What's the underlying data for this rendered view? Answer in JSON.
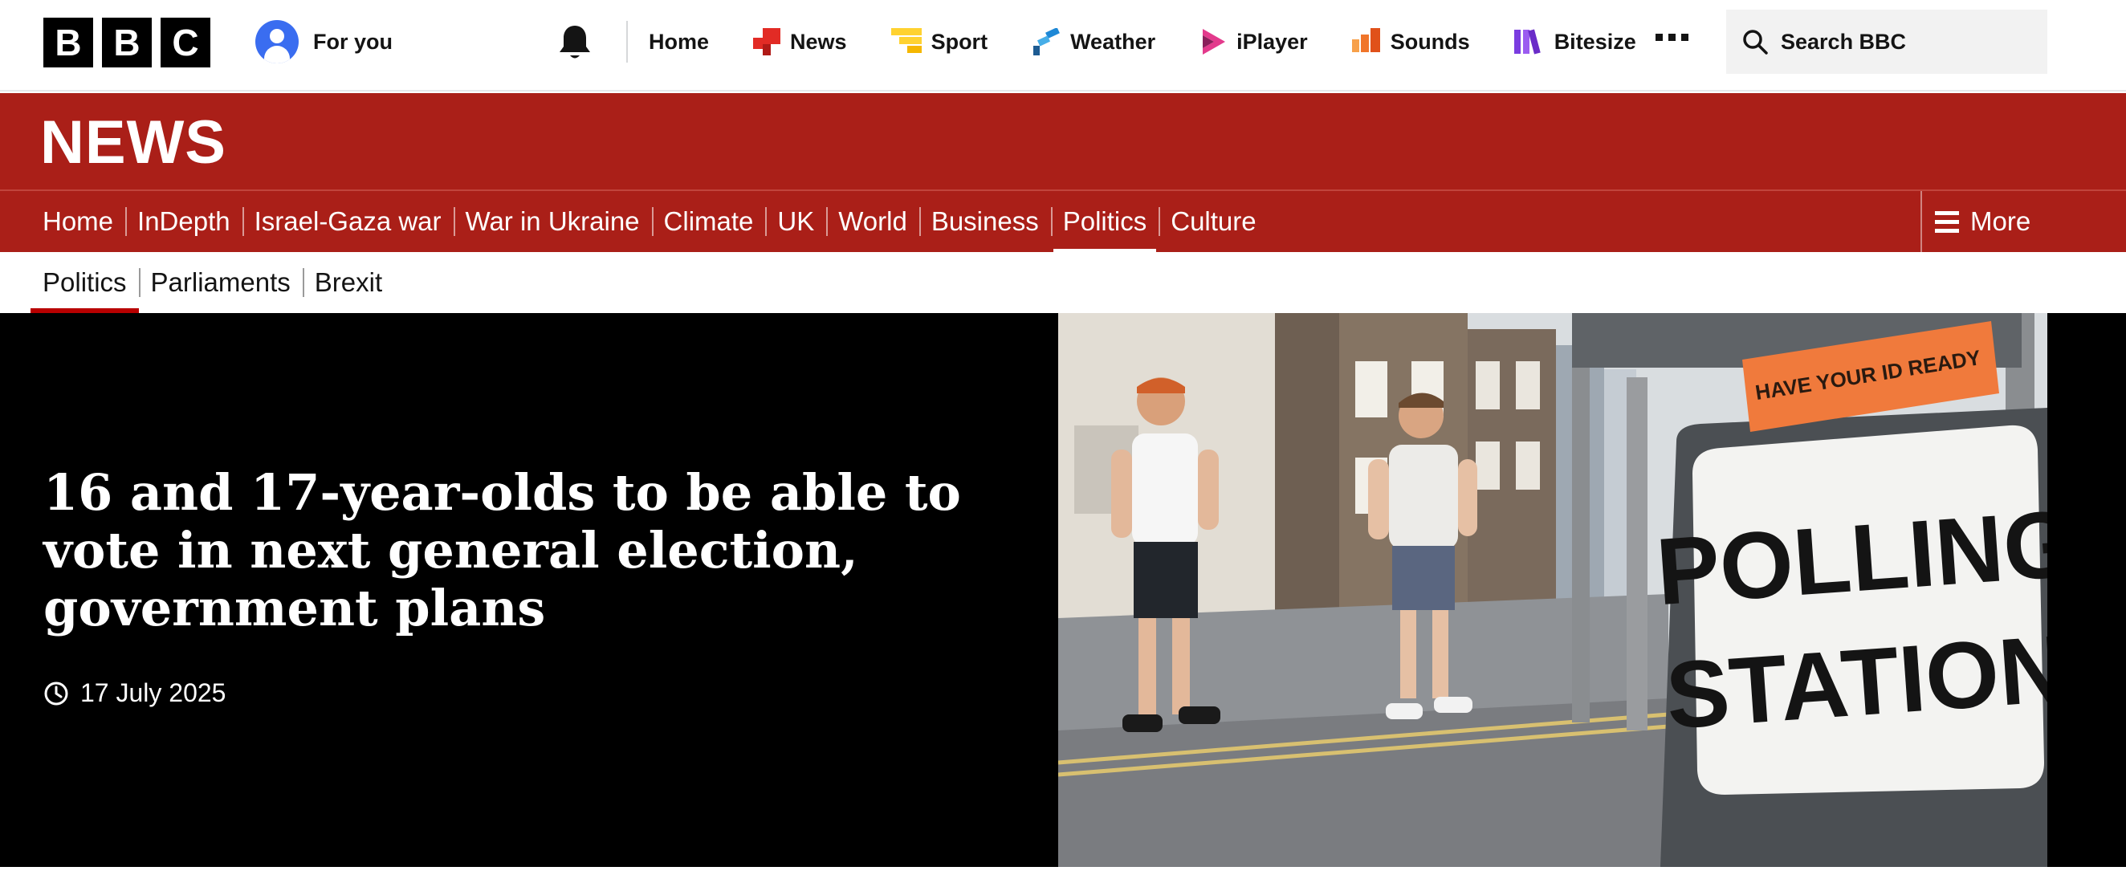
{
  "global_nav": {
    "logo_letters": [
      "B",
      "B",
      "C"
    ],
    "for_you": "For you",
    "items": [
      {
        "label": "Home",
        "icon": "none"
      },
      {
        "label": "News",
        "icon": "news-icon"
      },
      {
        "label": "Sport",
        "icon": "sport-icon"
      },
      {
        "label": "Weather",
        "icon": "weather-icon"
      },
      {
        "label": "iPlayer",
        "icon": "iplayer-icon"
      },
      {
        "label": "Sounds",
        "icon": "sounds-icon"
      },
      {
        "label": "Bitesize",
        "icon": "bitesize-icon"
      }
    ],
    "search_label": "Search BBC"
  },
  "news_section": {
    "wordmark": "NEWS",
    "nav": [
      {
        "label": "Home"
      },
      {
        "label": "InDepth"
      },
      {
        "label": "Israel-Gaza war"
      },
      {
        "label": "War in Ukraine"
      },
      {
        "label": "Climate"
      },
      {
        "label": "UK"
      },
      {
        "label": "World"
      },
      {
        "label": "Business"
      },
      {
        "label": "Politics",
        "active": true
      },
      {
        "label": "Culture"
      }
    ],
    "more_label": "More"
  },
  "sub_nav": [
    {
      "label": "Politics",
      "active": true
    },
    {
      "label": "Parliaments"
    },
    {
      "label": "Brexit"
    }
  ],
  "hero": {
    "headline": "16 and 17-year-olds to be able to vote in next general election, government plans",
    "date": "17 July 2025",
    "photo": {
      "sign_top": "HAVE YOUR ID READY",
      "sign_line1": "POLLING",
      "sign_line2": "STATION"
    }
  },
  "colors": {
    "news_red": "#aa1f18",
    "active_underline": "#b80000",
    "foryou_blue": "#3a6df0"
  }
}
